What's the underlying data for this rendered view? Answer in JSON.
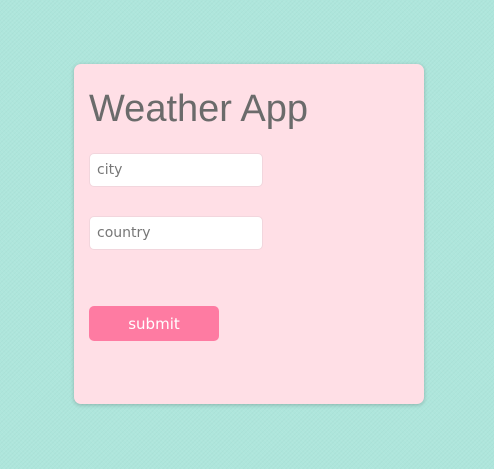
{
  "app": {
    "title": "Weather App"
  },
  "form": {
    "city": {
      "placeholder": "city",
      "value": ""
    },
    "country": {
      "placeholder": "country",
      "value": ""
    },
    "submit_label": "submit"
  },
  "colors": {
    "page_background": "#aee6dc",
    "card_background": "#ffdfe6",
    "title_text": "#6b6b6b",
    "button_background": "#fe7ba2",
    "button_text": "#ffffff"
  }
}
